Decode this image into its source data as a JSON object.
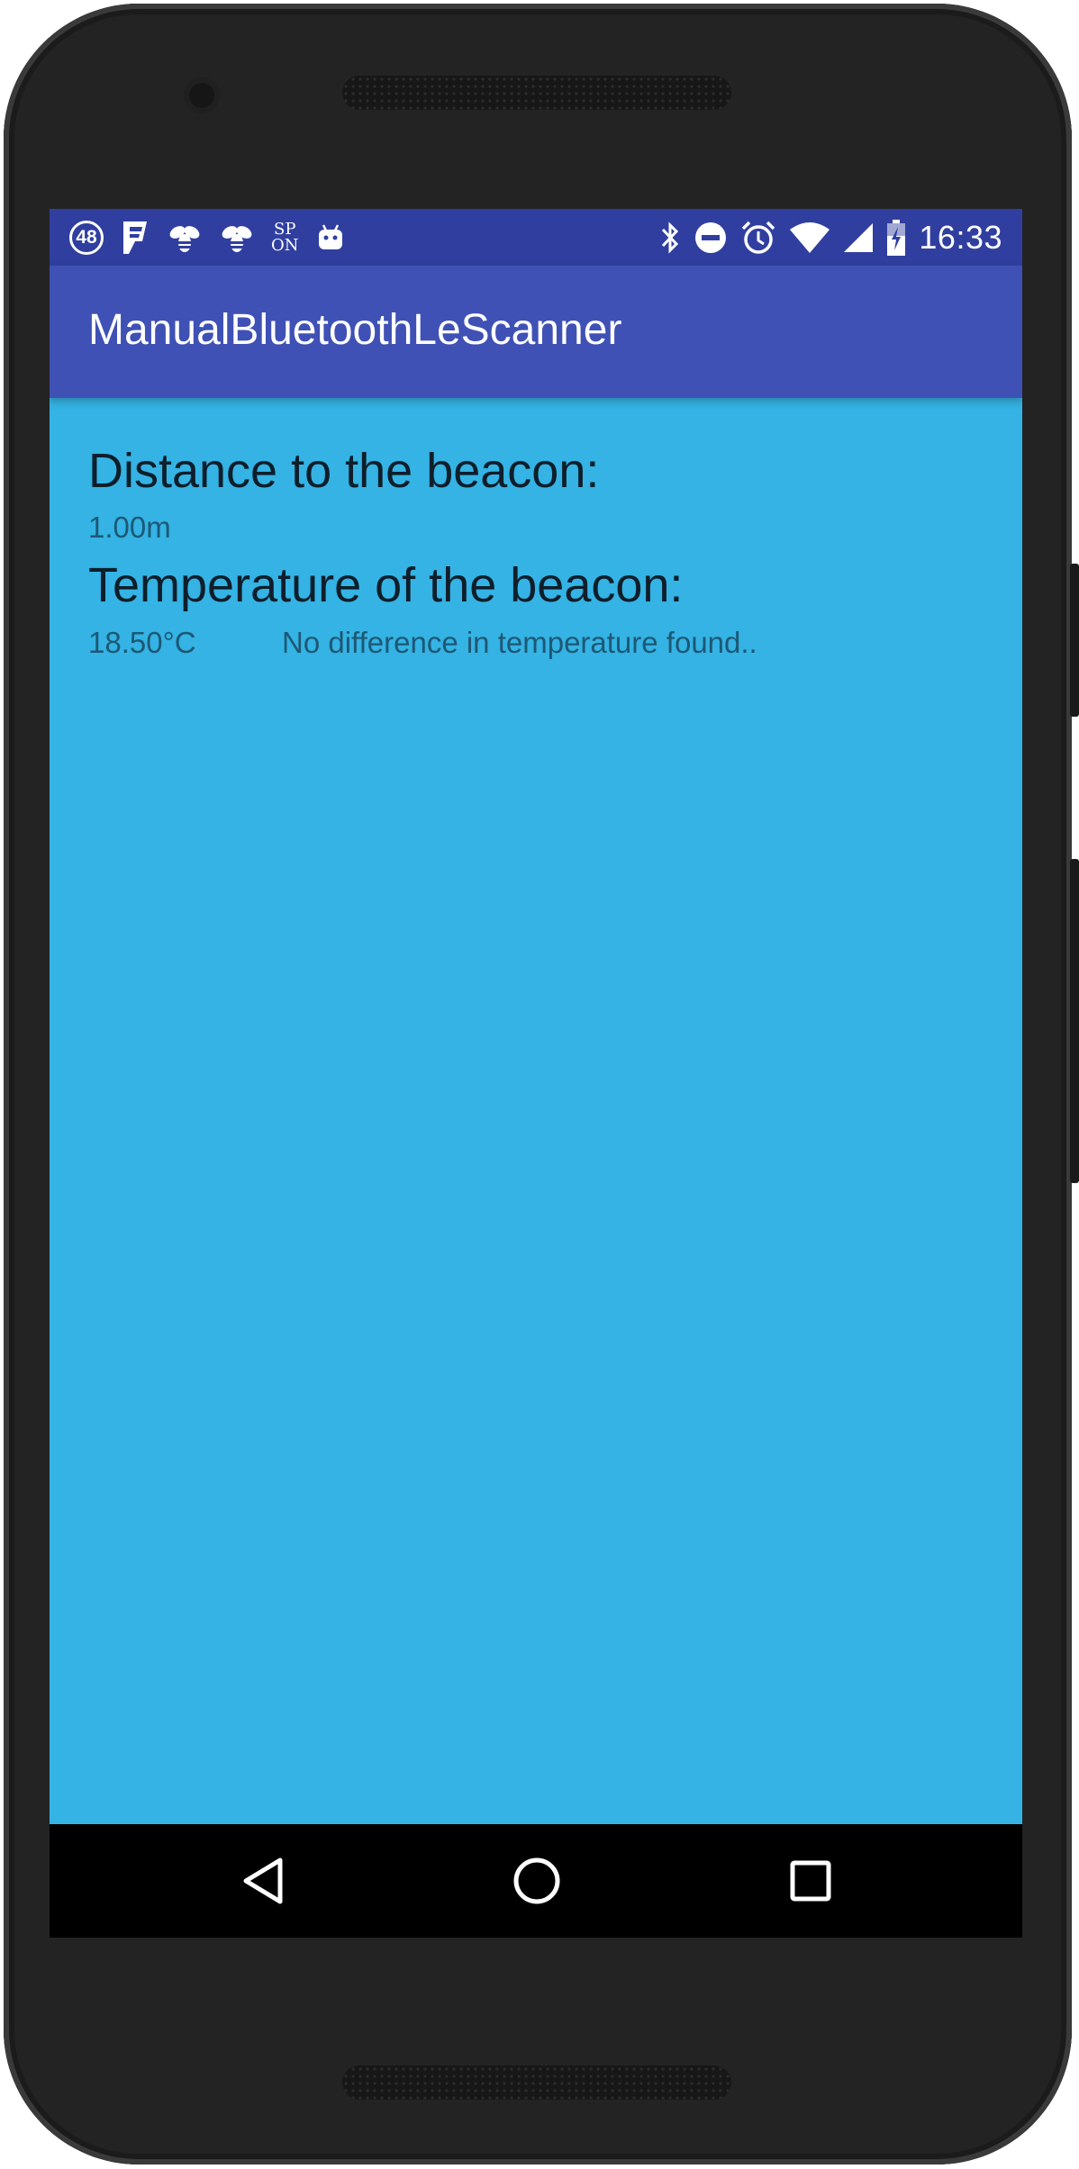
{
  "status_bar": {
    "time": "16:33",
    "notification_badge": "48",
    "sp_top": "SP",
    "sp_bottom": "ON",
    "left_icons": [
      "badge-48-icon",
      "foursquare-icon",
      "bee-icon",
      "bee-icon",
      "sp-on-icon",
      "android-icon"
    ],
    "right_icons": [
      "bluetooth-icon",
      "do-not-disturb-icon",
      "alarm-icon",
      "wifi-icon",
      "cell-signal-icon",
      "battery-charging-icon"
    ]
  },
  "app_bar": {
    "title": "ManualBluetoothLeScanner"
  },
  "main": {
    "distance_heading": "Distance to the beacon:",
    "distance_value": "1.00m",
    "temperature_heading": "Temperature of the beacon:",
    "temperature_value": "18.50°C",
    "temperature_status": "No difference in temperature found.."
  },
  "nav_bar": {
    "buttons": [
      "back-icon",
      "home-icon",
      "recent-apps-icon"
    ]
  },
  "colors": {
    "status_bar": "#303f9f",
    "app_bar": "#3f51b5",
    "background": "#34b3e4",
    "heading_text": "#0e1e2a",
    "value_text": "#1d5875"
  }
}
